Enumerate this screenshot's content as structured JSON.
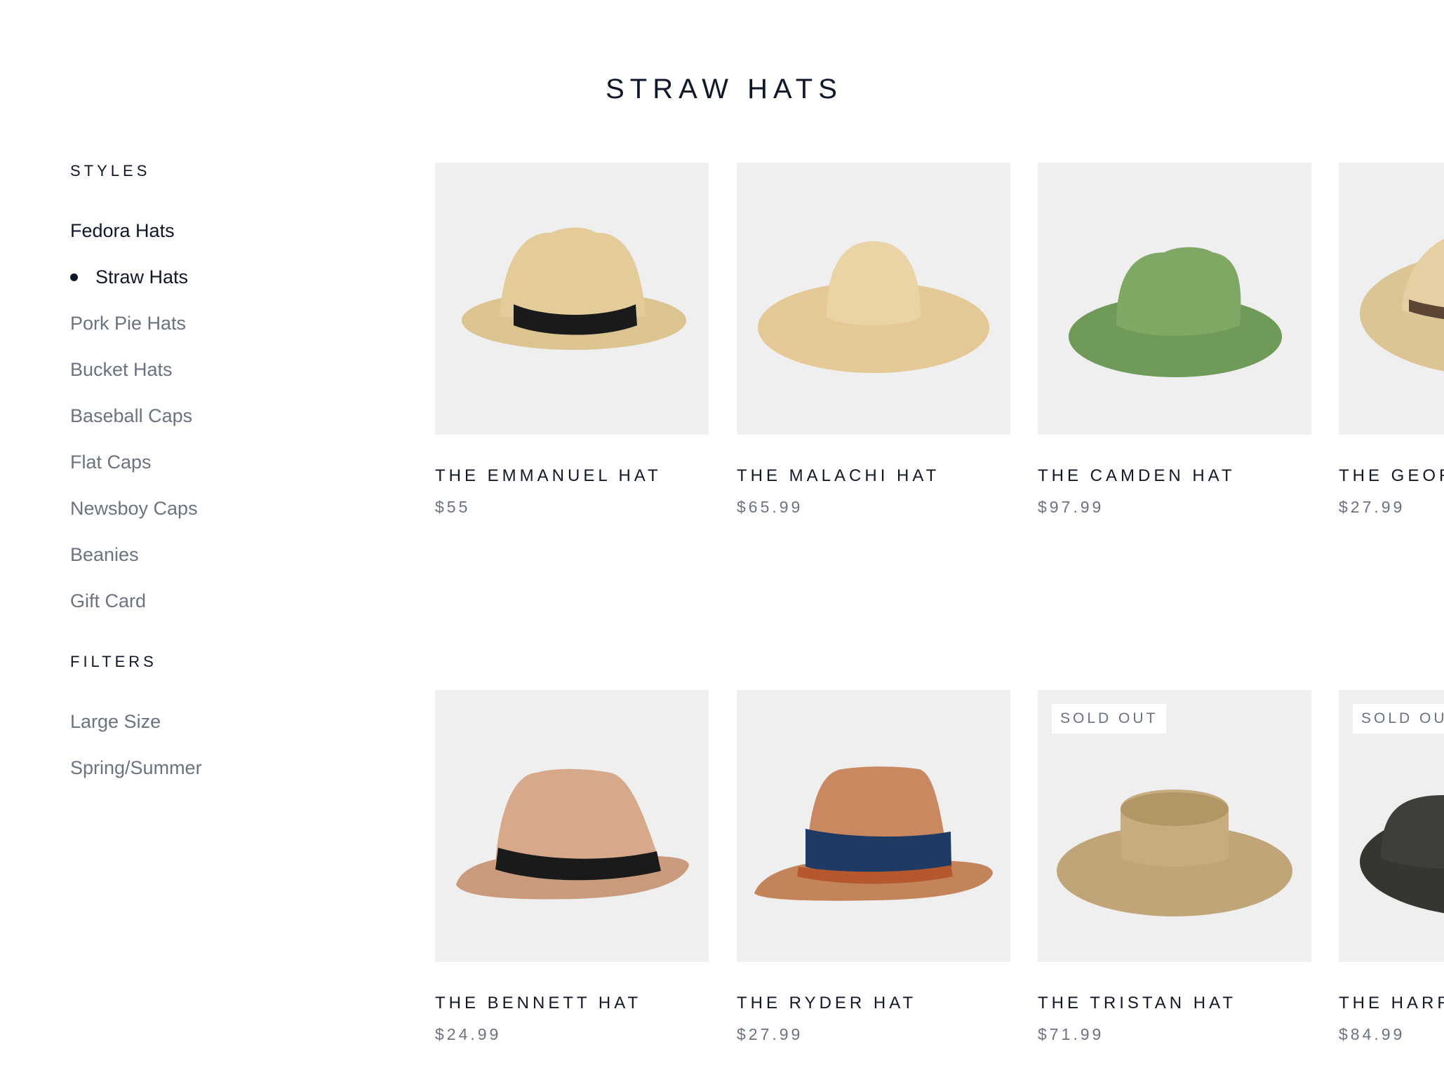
{
  "page": {
    "title": "STRAW HATS"
  },
  "sidebar": {
    "styles_title": "STYLES",
    "styles": [
      {
        "label": "Fedora Hats",
        "state": "normal-dark"
      },
      {
        "label": "Straw Hats",
        "state": "active"
      },
      {
        "label": "Pork Pie Hats",
        "state": "normal"
      },
      {
        "label": "Bucket Hats",
        "state": "normal"
      },
      {
        "label": "Baseball Caps",
        "state": "normal"
      },
      {
        "label": "Flat Caps",
        "state": "normal"
      },
      {
        "label": "Newsboy Caps",
        "state": "normal"
      },
      {
        "label": "Beanies",
        "state": "normal"
      },
      {
        "label": "Gift Card",
        "state": "normal"
      }
    ],
    "filters_title": "FILTERS",
    "filters": [
      {
        "label": "Large Size"
      },
      {
        "label": "Spring/Summer"
      }
    ]
  },
  "products": [
    {
      "name": "THE EMMANUEL HAT",
      "price": "$55",
      "badge": "",
      "hat_color": "#e3cc9a",
      "band_color": "#1a1a1a",
      "icon": "fedora-straw-hat-icon"
    },
    {
      "name": "THE MALACHI HAT",
      "price": "$65.99",
      "badge": "",
      "hat_color": "#ead3a4",
      "band_color": "",
      "icon": "wide-brim-straw-hat-icon"
    },
    {
      "name": "THE CAMDEN HAT",
      "price": "$97.99",
      "badge": "",
      "hat_color": "#7fa865",
      "band_color": "",
      "icon": "green-fedora-hat-icon"
    },
    {
      "name": "THE GEOR",
      "price": "$27.99",
      "badge": "",
      "hat_color": "#e5cfa3",
      "band_color": "#5a4632",
      "icon": "straw-cowboy-hat-icon"
    },
    {
      "name": "THE BENNETT HAT",
      "price": "$24.99",
      "badge": "",
      "hat_color": "#d6a98a",
      "band_color": "#1a1a1a",
      "icon": "trilby-hat-icon"
    },
    {
      "name": "THE RYDER HAT",
      "price": "$27.99",
      "badge": "",
      "hat_color": "#c9885f",
      "band_color": "#1f3b63",
      "icon": "trilby-braided-band-hat-icon"
    },
    {
      "name": "THE TRISTAN HAT",
      "price": "$71.99",
      "badge": "SOLD OUT",
      "hat_color": "#c6ac7e",
      "band_color": "",
      "icon": "boater-hat-icon"
    },
    {
      "name": "THE HARR",
      "price": "$84.99",
      "badge": "SOLD OU",
      "hat_color": "#3d3f3a",
      "band_color": "",
      "icon": "dark-wide-brim-hat-icon"
    }
  ]
}
